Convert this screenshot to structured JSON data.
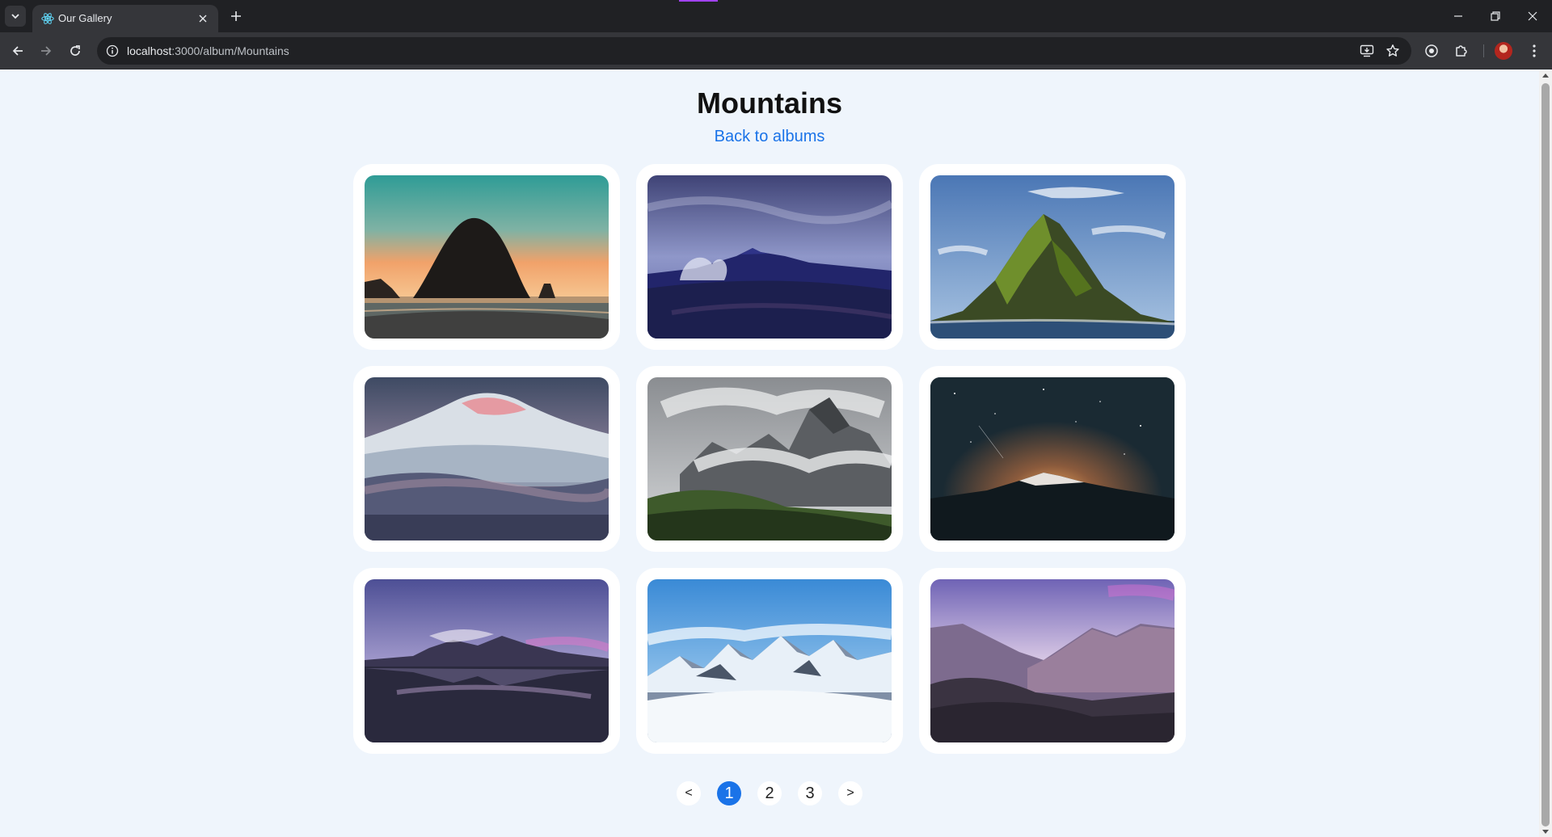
{
  "browser": {
    "tab": {
      "title": "Our Gallery"
    },
    "address": {
      "host": "localhost",
      "path": ":3000/album/Mountains"
    },
    "icons": {
      "tab_menu": "chevron-down-icon",
      "favicon": "react-icon",
      "tab_close": "close-icon",
      "new_tab": "plus-icon",
      "back": "arrow-left-icon",
      "forward": "arrow-right-icon",
      "reload": "reload-icon",
      "site_info": "info-icon",
      "install_app": "install-icon",
      "bookmark": "star-icon",
      "extension_a": "target-icon",
      "extensions": "puzzle-icon",
      "profile": "avatar",
      "menu": "kebab-menu-icon",
      "minimize": "minimize-icon",
      "restore": "restore-icon",
      "close_window": "close-icon"
    }
  },
  "page": {
    "title": "Mountains",
    "back_link": "Back to albums",
    "photos_description": [
      "sea stack at sunset",
      "volcano with steam",
      "green rocky island peak",
      "snowy volcano at dusk",
      "clouded alpine peaks",
      "mountain under starry sky",
      "mountain reflected on beach",
      "snowy alpine range",
      "rocky ridge at twilight"
    ]
  },
  "pagination": {
    "prev": "<",
    "pages": [
      "1",
      "2",
      "3"
    ],
    "current": "1",
    "next": ">"
  },
  "colors": {
    "accent": "#1a73e8",
    "page_background": "#eff5fc",
    "card_background": "#ffffff",
    "chrome_dark": "#202124",
    "chrome_toolbar": "#35363a"
  }
}
